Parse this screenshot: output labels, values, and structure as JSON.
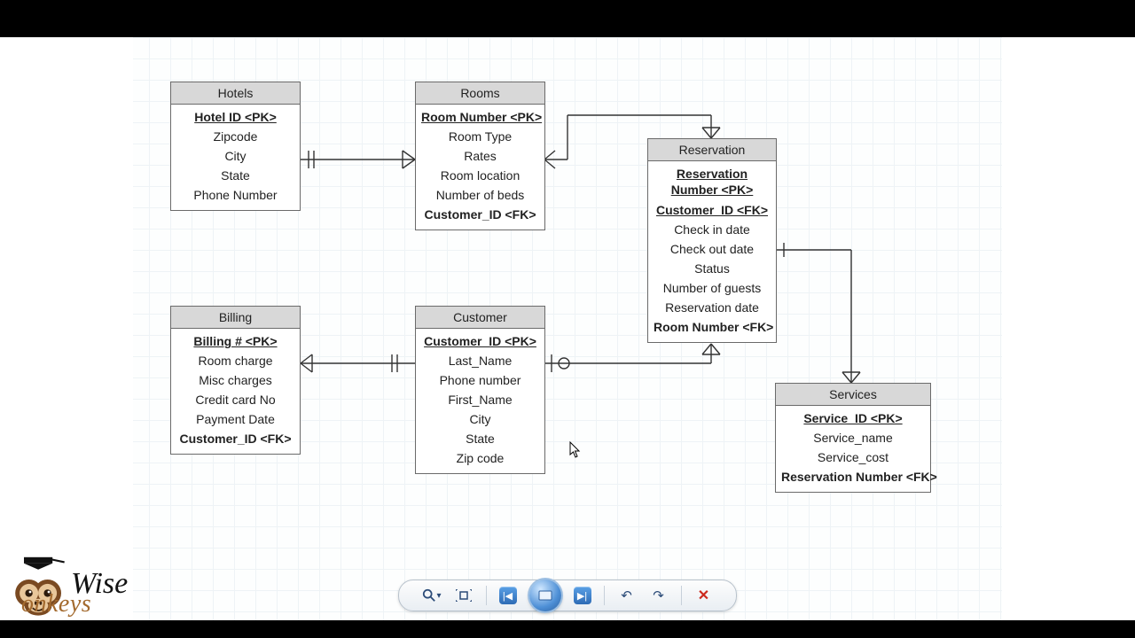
{
  "entities": {
    "hotels": {
      "title": "Hotels",
      "rows": [
        {
          "t": "Hotel ID <PK>",
          "cls": "pk"
        },
        {
          "t": "Zipcode"
        },
        {
          "t": "City"
        },
        {
          "t": "State"
        },
        {
          "t": "Phone Number"
        }
      ]
    },
    "rooms": {
      "title": "Rooms",
      "rows": [
        {
          "t": "Room Number <PK>",
          "cls": "pk"
        },
        {
          "t": "Room Type"
        },
        {
          "t": "Rates"
        },
        {
          "t": "Room location"
        },
        {
          "t": "Number of beds"
        },
        {
          "t": "Customer_ID <FK>",
          "cls": "fk"
        }
      ]
    },
    "reservation": {
      "title": "Reservation",
      "rows": [
        {
          "t": "Reservation Number <PK>",
          "cls": "pk",
          "wrap": true
        },
        {
          "t": "Customer_ID <FK>",
          "cls": "pk"
        },
        {
          "t": "Check in date"
        },
        {
          "t": "Check out date"
        },
        {
          "t": "Status"
        },
        {
          "t": "Number of guests"
        },
        {
          "t": "Reservation date"
        },
        {
          "t": "Room Number <FK>",
          "cls": "fk"
        }
      ]
    },
    "billing": {
      "title": "Billing",
      "rows": [
        {
          "t": "Billing # <PK>",
          "cls": "pk"
        },
        {
          "t": "Room charge"
        },
        {
          "t": "Misc charges"
        },
        {
          "t": "Credit card No"
        },
        {
          "t": "Payment Date"
        },
        {
          "t": "Customer_ID <FK>",
          "cls": "fk"
        }
      ]
    },
    "customer": {
      "title": "Customer",
      "rows": [
        {
          "t": "Customer_ID <PK>",
          "cls": "pk"
        },
        {
          "t": "Last_Name"
        },
        {
          "t": "Phone number"
        },
        {
          "t": "First_Name"
        },
        {
          "t": "City"
        },
        {
          "t": "State"
        },
        {
          "t": "Zip code"
        }
      ]
    },
    "services": {
      "title": "Services",
      "rows": [
        {
          "t": "Service_ID <PK>",
          "cls": "pk"
        },
        {
          "t": "Service_name"
        },
        {
          "t": "Service_cost"
        },
        {
          "t": "Reservation Number <FK>",
          "cls": "fk"
        }
      ]
    }
  },
  "logo": {
    "line1": "Wise",
    "line2": "onkeys"
  },
  "toolbar": {
    "zoom": "zoom",
    "fit": "fit",
    "first": "first",
    "prev": "prev",
    "next": "next",
    "undo": "↶",
    "redo": "↷",
    "close": "✕"
  }
}
